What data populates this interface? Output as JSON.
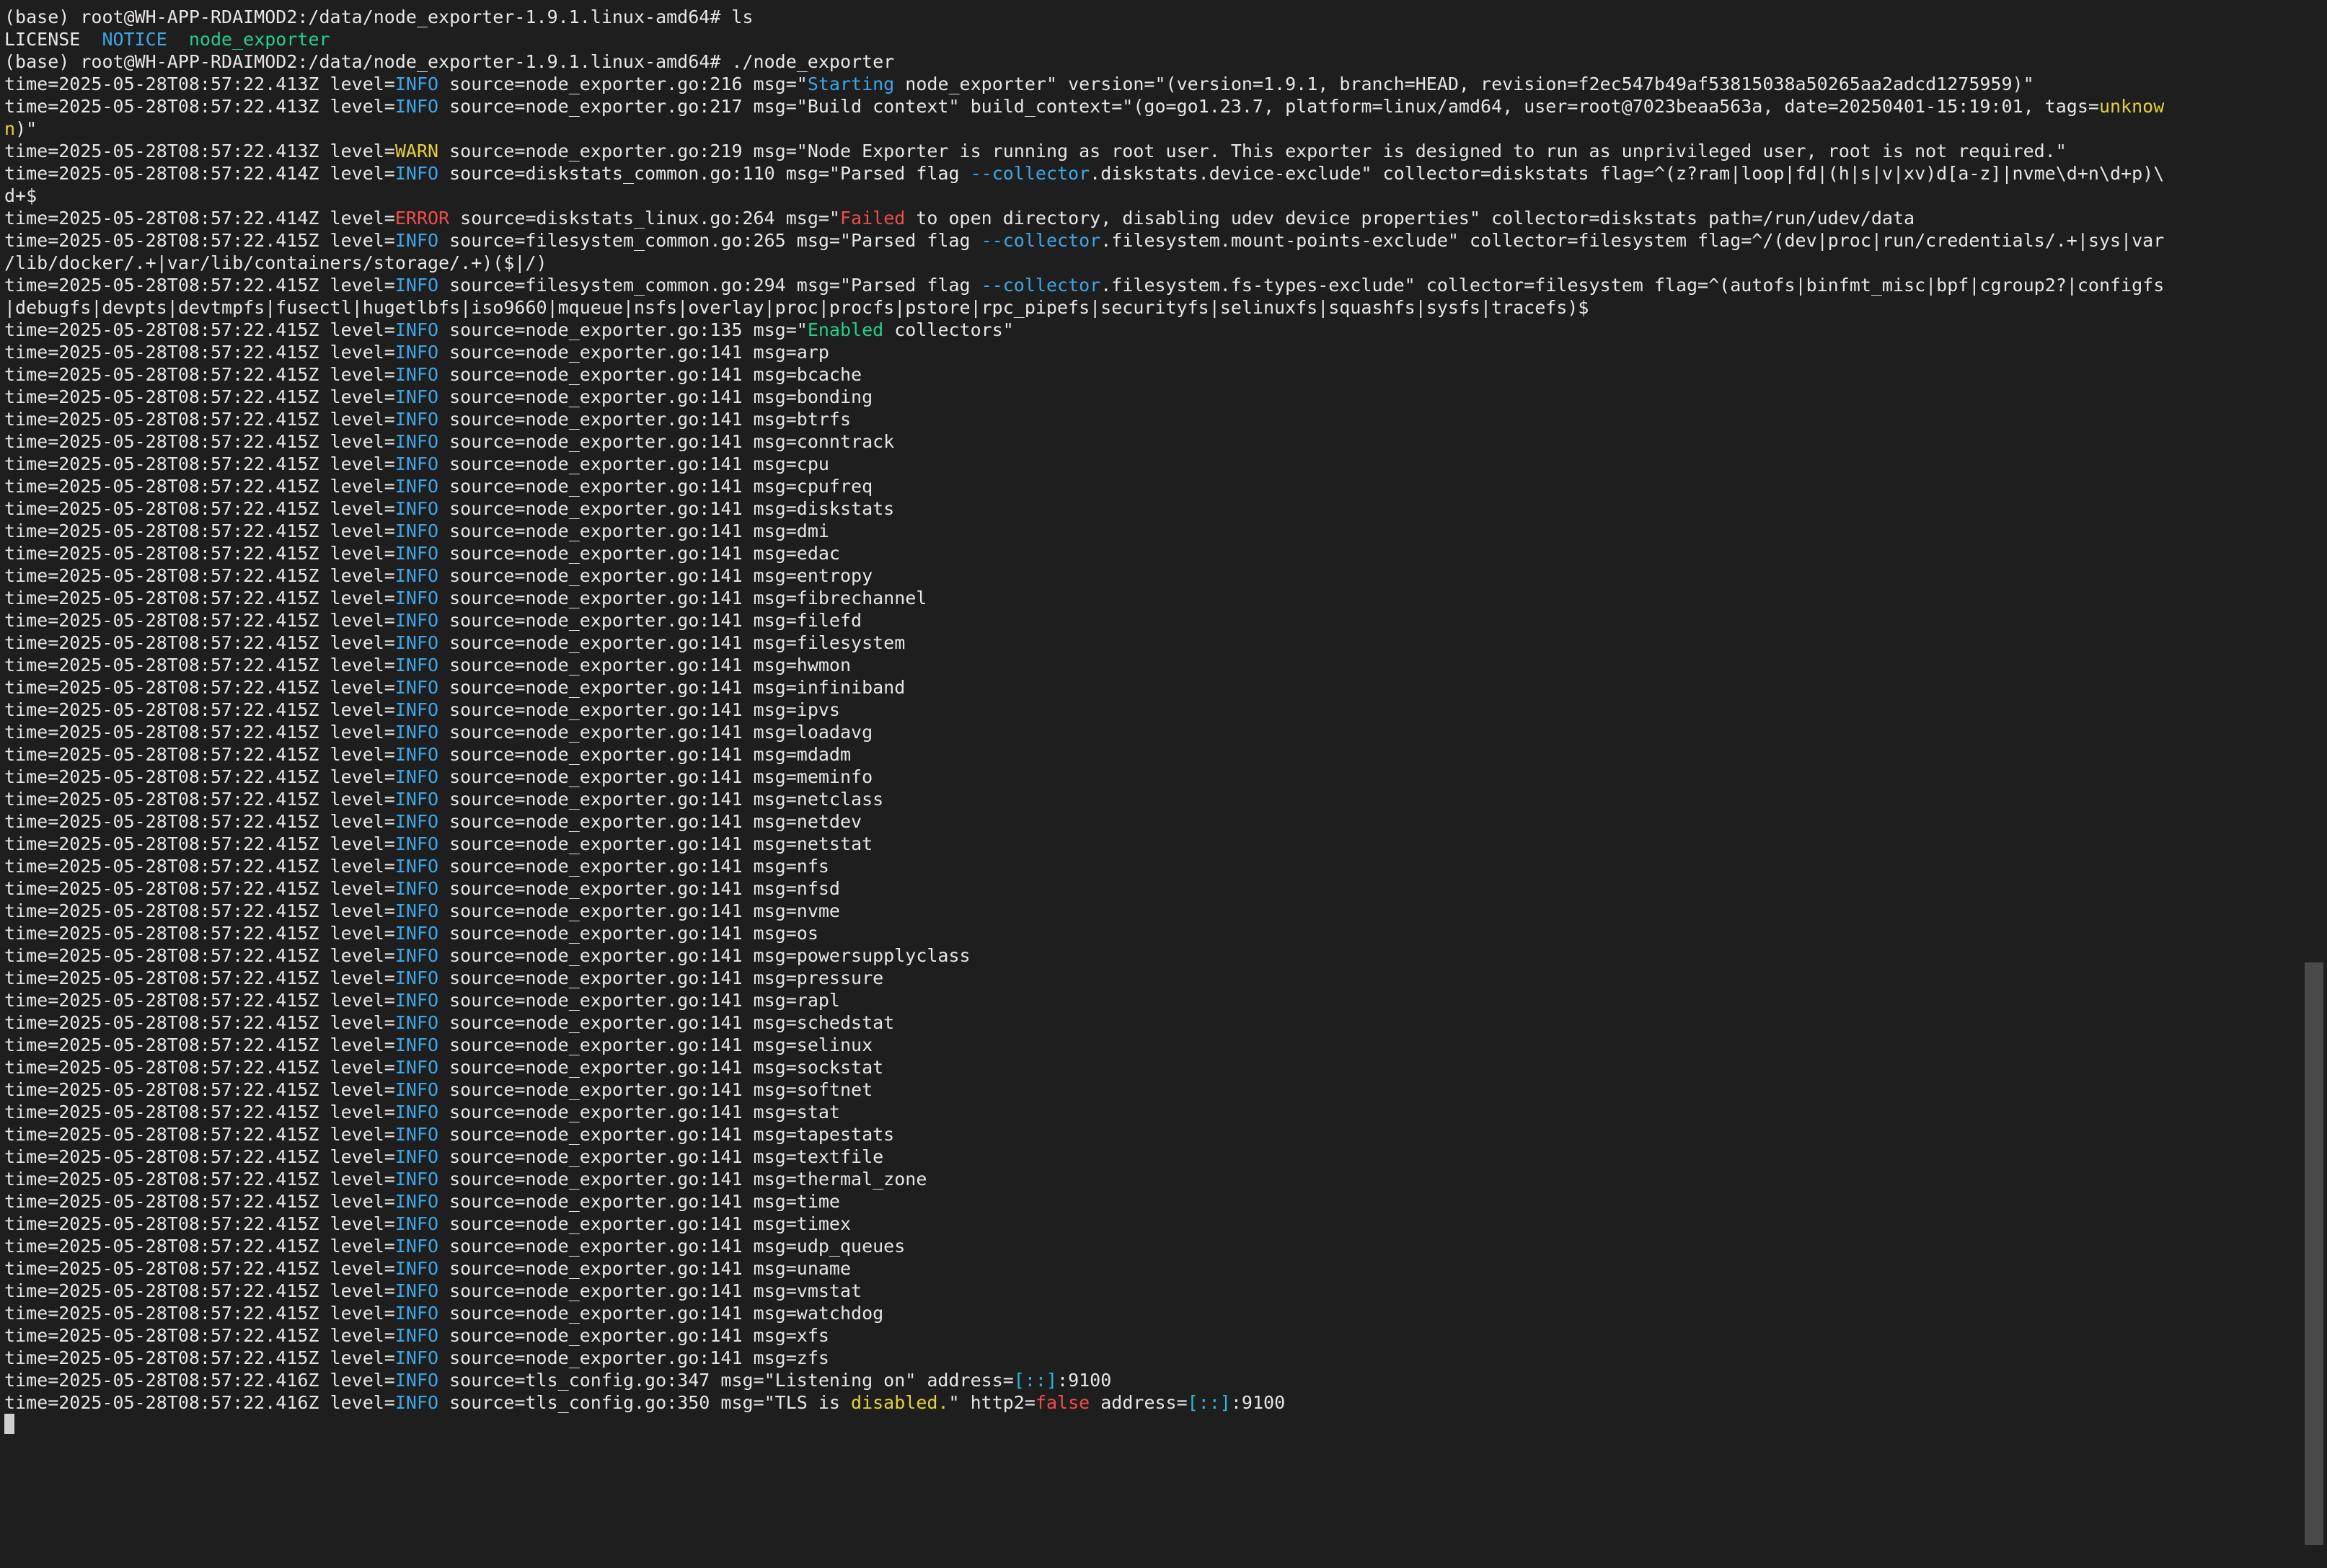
{
  "theme": {
    "background": "#1e1e1e",
    "foreground": "#e6e6e6",
    "info": "#3ea6e6",
    "warn": "#e5d23a",
    "error": "#f14c4c",
    "green": "#23d18b",
    "cyan": "#29b8db"
  },
  "terminal": {
    "lines": [
      [
        {
          "t": "(base) root@WH-APP-RDAIMOD2:/data/node_exporter-1.9.1.linux-amd64# ls",
          "c": "fg"
        }
      ],
      [
        {
          "t": "LICENSE  ",
          "c": "fg"
        },
        {
          "t": "NOTICE",
          "c": "blue"
        },
        {
          "t": "  node_exporter",
          "c": "green"
        }
      ],
      [
        {
          "t": "(base) root@WH-APP-RDAIMOD2:/data/node_exporter-1.9.1.linux-amd64# ./node_exporter",
          "c": "fg"
        }
      ],
      [
        {
          "t": "time=2025-05-28T08:57:22.413Z level=",
          "c": "fg"
        },
        {
          "t": "INFO",
          "c": "info"
        },
        {
          "t": " source=node_exporter.go:216 msg=\"",
          "c": "fg"
        },
        {
          "t": "Starting",
          "c": "blue"
        },
        {
          "t": " node_exporter\" version=\"(version=1.9.1, branch=HEAD, revision=f2ec547b49af53815038a50265aa2adcd1275959)\"",
          "c": "fg"
        }
      ],
      [
        {
          "t": "time=2025-05-28T08:57:22.413Z level=",
          "c": "fg"
        },
        {
          "t": "INFO",
          "c": "info"
        },
        {
          "t": " source=node_exporter.go:217 msg=\"Build context\" build_context=\"(go=go1.23.7, platform=linux/amd64, user=root@7023beaa563a, date=20250401-15:19:01, tags=",
          "c": "fg"
        },
        {
          "t": "unknow",
          "c": "yellow"
        }
      ],
      [
        {
          "t": "n",
          "c": "yellow"
        },
        {
          "t": ")\"",
          "c": "fg"
        }
      ],
      [
        {
          "t": "time=2025-05-28T08:57:22.413Z level=",
          "c": "fg"
        },
        {
          "t": "WARN",
          "c": "warn"
        },
        {
          "t": " source=node_exporter.go:219 msg=\"Node Exporter is running as root user. This exporter is designed to run as unprivileged user, root is not required.\"",
          "c": "fg"
        }
      ],
      [
        {
          "t": "time=2025-05-28T08:57:22.414Z level=",
          "c": "fg"
        },
        {
          "t": "INFO",
          "c": "info"
        },
        {
          "t": " source=diskstats_common.go:110 msg=\"Parsed flag ",
          "c": "fg"
        },
        {
          "t": "--collector",
          "c": "blue"
        },
        {
          "t": ".diskstats.device-exclude\" collector=diskstats flag=^(z?ram|loop|fd|(h|s|v|xv)d[a-z]|nvme\\d+n\\d+p)\\",
          "c": "fg"
        }
      ],
      [
        {
          "t": "d+$",
          "c": "fg"
        }
      ],
      [
        {
          "t": "time=2025-05-28T08:57:22.414Z level=",
          "c": "fg"
        },
        {
          "t": "ERROR",
          "c": "error"
        },
        {
          "t": " source=diskstats_linux.go:264 msg=\"",
          "c": "fg"
        },
        {
          "t": "Failed",
          "c": "red"
        },
        {
          "t": " to open directory, disabling udev device properties\" collector=diskstats path=/run/udev/data",
          "c": "fg"
        }
      ],
      [
        {
          "t": "time=2025-05-28T08:57:22.415Z level=",
          "c": "fg"
        },
        {
          "t": "INFO",
          "c": "info"
        },
        {
          "t": " source=filesystem_common.go:265 msg=\"Parsed flag ",
          "c": "fg"
        },
        {
          "t": "--collector",
          "c": "blue"
        },
        {
          "t": ".filesystem.mount-points-exclude\" collector=filesystem flag=^/(dev|proc|run/credentials/.+|sys|var",
          "c": "fg"
        }
      ],
      [
        {
          "t": "/lib/docker/.+|var/lib/containers/storage/.+)($|/)",
          "c": "fg"
        }
      ],
      [
        {
          "t": "time=2025-05-28T08:57:22.415Z level=",
          "c": "fg"
        },
        {
          "t": "INFO",
          "c": "info"
        },
        {
          "t": " source=filesystem_common.go:294 msg=\"Parsed flag ",
          "c": "fg"
        },
        {
          "t": "--collector",
          "c": "blue"
        },
        {
          "t": ".filesystem.fs-types-exclude\" collector=filesystem flag=^(autofs|binfmt_misc|bpf|cgroup2?|configfs",
          "c": "fg"
        }
      ],
      [
        {
          "t": "|debugfs|devpts|devtmpfs|fusectl|hugetlbfs|iso9660|mqueue|nsfs|overlay|proc|procfs|pstore|rpc_pipefs|securityfs|selinuxfs|squashfs|sysfs|tracefs)$",
          "c": "fg"
        }
      ],
      [
        {
          "t": "time=2025-05-28T08:57:22.415Z level=",
          "c": "fg"
        },
        {
          "t": "INFO",
          "c": "info"
        },
        {
          "t": " source=node_exporter.go:135 msg=\"",
          "c": "fg"
        },
        {
          "t": "Enabled",
          "c": "green"
        },
        {
          "t": " collectors\"",
          "c": "fg"
        }
      ],
      [
        {
          "t": "time=2025-05-28T08:57:22.415Z level=",
          "c": "fg"
        },
        {
          "t": "INFO",
          "c": "info"
        },
        {
          "t": " source=node_exporter.go:141 msg=arp",
          "c": "fg"
        }
      ],
      [
        {
          "t": "time=2025-05-28T08:57:22.415Z level=",
          "c": "fg"
        },
        {
          "t": "INFO",
          "c": "info"
        },
        {
          "t": " source=node_exporter.go:141 msg=bcache",
          "c": "fg"
        }
      ],
      [
        {
          "t": "time=2025-05-28T08:57:22.415Z level=",
          "c": "fg"
        },
        {
          "t": "INFO",
          "c": "info"
        },
        {
          "t": " source=node_exporter.go:141 msg=bonding",
          "c": "fg"
        }
      ],
      [
        {
          "t": "time=2025-05-28T08:57:22.415Z level=",
          "c": "fg"
        },
        {
          "t": "INFO",
          "c": "info"
        },
        {
          "t": " source=node_exporter.go:141 msg=btrfs",
          "c": "fg"
        }
      ],
      [
        {
          "t": "time=2025-05-28T08:57:22.415Z level=",
          "c": "fg"
        },
        {
          "t": "INFO",
          "c": "info"
        },
        {
          "t": " source=node_exporter.go:141 msg=conntrack",
          "c": "fg"
        }
      ],
      [
        {
          "t": "time=2025-05-28T08:57:22.415Z level=",
          "c": "fg"
        },
        {
          "t": "INFO",
          "c": "info"
        },
        {
          "t": " source=node_exporter.go:141 msg=cpu",
          "c": "fg"
        }
      ],
      [
        {
          "t": "time=2025-05-28T08:57:22.415Z level=",
          "c": "fg"
        },
        {
          "t": "INFO",
          "c": "info"
        },
        {
          "t": " source=node_exporter.go:141 msg=cpufreq",
          "c": "fg"
        }
      ],
      [
        {
          "t": "time=2025-05-28T08:57:22.415Z level=",
          "c": "fg"
        },
        {
          "t": "INFO",
          "c": "info"
        },
        {
          "t": " source=node_exporter.go:141 msg=diskstats",
          "c": "fg"
        }
      ],
      [
        {
          "t": "time=2025-05-28T08:57:22.415Z level=",
          "c": "fg"
        },
        {
          "t": "INFO",
          "c": "info"
        },
        {
          "t": " source=node_exporter.go:141 msg=dmi",
          "c": "fg"
        }
      ],
      [
        {
          "t": "time=2025-05-28T08:57:22.415Z level=",
          "c": "fg"
        },
        {
          "t": "INFO",
          "c": "info"
        },
        {
          "t": " source=node_exporter.go:141 msg=edac",
          "c": "fg"
        }
      ],
      [
        {
          "t": "time=2025-05-28T08:57:22.415Z level=",
          "c": "fg"
        },
        {
          "t": "INFO",
          "c": "info"
        },
        {
          "t": " source=node_exporter.go:141 msg=entropy",
          "c": "fg"
        }
      ],
      [
        {
          "t": "time=2025-05-28T08:57:22.415Z level=",
          "c": "fg"
        },
        {
          "t": "INFO",
          "c": "info"
        },
        {
          "t": " source=node_exporter.go:141 msg=fibrechannel",
          "c": "fg"
        }
      ],
      [
        {
          "t": "time=2025-05-28T08:57:22.415Z level=",
          "c": "fg"
        },
        {
          "t": "INFO",
          "c": "info"
        },
        {
          "t": " source=node_exporter.go:141 msg=filefd",
          "c": "fg"
        }
      ],
      [
        {
          "t": "time=2025-05-28T08:57:22.415Z level=",
          "c": "fg"
        },
        {
          "t": "INFO",
          "c": "info"
        },
        {
          "t": " source=node_exporter.go:141 msg=filesystem",
          "c": "fg"
        }
      ],
      [
        {
          "t": "time=2025-05-28T08:57:22.415Z level=",
          "c": "fg"
        },
        {
          "t": "INFO",
          "c": "info"
        },
        {
          "t": " source=node_exporter.go:141 msg=hwmon",
          "c": "fg"
        }
      ],
      [
        {
          "t": "time=2025-05-28T08:57:22.415Z level=",
          "c": "fg"
        },
        {
          "t": "INFO",
          "c": "info"
        },
        {
          "t": " source=node_exporter.go:141 msg=infiniband",
          "c": "fg"
        }
      ],
      [
        {
          "t": "time=2025-05-28T08:57:22.415Z level=",
          "c": "fg"
        },
        {
          "t": "INFO",
          "c": "info"
        },
        {
          "t": " source=node_exporter.go:141 msg=ipvs",
          "c": "fg"
        }
      ],
      [
        {
          "t": "time=2025-05-28T08:57:22.415Z level=",
          "c": "fg"
        },
        {
          "t": "INFO",
          "c": "info"
        },
        {
          "t": " source=node_exporter.go:141 msg=loadavg",
          "c": "fg"
        }
      ],
      [
        {
          "t": "time=2025-05-28T08:57:22.415Z level=",
          "c": "fg"
        },
        {
          "t": "INFO",
          "c": "info"
        },
        {
          "t": " source=node_exporter.go:141 msg=mdadm",
          "c": "fg"
        }
      ],
      [
        {
          "t": "time=2025-05-28T08:57:22.415Z level=",
          "c": "fg"
        },
        {
          "t": "INFO",
          "c": "info"
        },
        {
          "t": " source=node_exporter.go:141 msg=meminfo",
          "c": "fg"
        }
      ],
      [
        {
          "t": "time=2025-05-28T08:57:22.415Z level=",
          "c": "fg"
        },
        {
          "t": "INFO",
          "c": "info"
        },
        {
          "t": " source=node_exporter.go:141 msg=netclass",
          "c": "fg"
        }
      ],
      [
        {
          "t": "time=2025-05-28T08:57:22.415Z level=",
          "c": "fg"
        },
        {
          "t": "INFO",
          "c": "info"
        },
        {
          "t": " source=node_exporter.go:141 msg=netdev",
          "c": "fg"
        }
      ],
      [
        {
          "t": "time=2025-05-28T08:57:22.415Z level=",
          "c": "fg"
        },
        {
          "t": "INFO",
          "c": "info"
        },
        {
          "t": " source=node_exporter.go:141 msg=netstat",
          "c": "fg"
        }
      ],
      [
        {
          "t": "time=2025-05-28T08:57:22.415Z level=",
          "c": "fg"
        },
        {
          "t": "INFO",
          "c": "info"
        },
        {
          "t": " source=node_exporter.go:141 msg=nfs",
          "c": "fg"
        }
      ],
      [
        {
          "t": "time=2025-05-28T08:57:22.415Z level=",
          "c": "fg"
        },
        {
          "t": "INFO",
          "c": "info"
        },
        {
          "t": " source=node_exporter.go:141 msg=nfsd",
          "c": "fg"
        }
      ],
      [
        {
          "t": "time=2025-05-28T08:57:22.415Z level=",
          "c": "fg"
        },
        {
          "t": "INFO",
          "c": "info"
        },
        {
          "t": " source=node_exporter.go:141 msg=nvme",
          "c": "fg"
        }
      ],
      [
        {
          "t": "time=2025-05-28T08:57:22.415Z level=",
          "c": "fg"
        },
        {
          "t": "INFO",
          "c": "info"
        },
        {
          "t": " source=node_exporter.go:141 msg=os",
          "c": "fg"
        }
      ],
      [
        {
          "t": "time=2025-05-28T08:57:22.415Z level=",
          "c": "fg"
        },
        {
          "t": "INFO",
          "c": "info"
        },
        {
          "t": " source=node_exporter.go:141 msg=powersupplyclass",
          "c": "fg"
        }
      ],
      [
        {
          "t": "time=2025-05-28T08:57:22.415Z level=",
          "c": "fg"
        },
        {
          "t": "INFO",
          "c": "info"
        },
        {
          "t": " source=node_exporter.go:141 msg=pressure",
          "c": "fg"
        }
      ],
      [
        {
          "t": "time=2025-05-28T08:57:22.415Z level=",
          "c": "fg"
        },
        {
          "t": "INFO",
          "c": "info"
        },
        {
          "t": " source=node_exporter.go:141 msg=rapl",
          "c": "fg"
        }
      ],
      [
        {
          "t": "time=2025-05-28T08:57:22.415Z level=",
          "c": "fg"
        },
        {
          "t": "INFO",
          "c": "info"
        },
        {
          "t": " source=node_exporter.go:141 msg=schedstat",
          "c": "fg"
        }
      ],
      [
        {
          "t": "time=2025-05-28T08:57:22.415Z level=",
          "c": "fg"
        },
        {
          "t": "INFO",
          "c": "info"
        },
        {
          "t": " source=node_exporter.go:141 msg=selinux",
          "c": "fg"
        }
      ],
      [
        {
          "t": "time=2025-05-28T08:57:22.415Z level=",
          "c": "fg"
        },
        {
          "t": "INFO",
          "c": "info"
        },
        {
          "t": " source=node_exporter.go:141 msg=sockstat",
          "c": "fg"
        }
      ],
      [
        {
          "t": "time=2025-05-28T08:57:22.415Z level=",
          "c": "fg"
        },
        {
          "t": "INFO",
          "c": "info"
        },
        {
          "t": " source=node_exporter.go:141 msg=softnet",
          "c": "fg"
        }
      ],
      [
        {
          "t": "time=2025-05-28T08:57:22.415Z level=",
          "c": "fg"
        },
        {
          "t": "INFO",
          "c": "info"
        },
        {
          "t": " source=node_exporter.go:141 msg=stat",
          "c": "fg"
        }
      ],
      [
        {
          "t": "time=2025-05-28T08:57:22.415Z level=",
          "c": "fg"
        },
        {
          "t": "INFO",
          "c": "info"
        },
        {
          "t": " source=node_exporter.go:141 msg=tapestats",
          "c": "fg"
        }
      ],
      [
        {
          "t": "time=2025-05-28T08:57:22.415Z level=",
          "c": "fg"
        },
        {
          "t": "INFO",
          "c": "info"
        },
        {
          "t": " source=node_exporter.go:141 msg=textfile",
          "c": "fg"
        }
      ],
      [
        {
          "t": "time=2025-05-28T08:57:22.415Z level=",
          "c": "fg"
        },
        {
          "t": "INFO",
          "c": "info"
        },
        {
          "t": " source=node_exporter.go:141 msg=thermal_zone",
          "c": "fg"
        }
      ],
      [
        {
          "t": "time=2025-05-28T08:57:22.415Z level=",
          "c": "fg"
        },
        {
          "t": "INFO",
          "c": "info"
        },
        {
          "t": " source=node_exporter.go:141 msg=time",
          "c": "fg"
        }
      ],
      [
        {
          "t": "time=2025-05-28T08:57:22.415Z level=",
          "c": "fg"
        },
        {
          "t": "INFO",
          "c": "info"
        },
        {
          "t": " source=node_exporter.go:141 msg=timex",
          "c": "fg"
        }
      ],
      [
        {
          "t": "time=2025-05-28T08:57:22.415Z level=",
          "c": "fg"
        },
        {
          "t": "INFO",
          "c": "info"
        },
        {
          "t": " source=node_exporter.go:141 msg=udp_queues",
          "c": "fg"
        }
      ],
      [
        {
          "t": "time=2025-05-28T08:57:22.415Z level=",
          "c": "fg"
        },
        {
          "t": "INFO",
          "c": "info"
        },
        {
          "t": " source=node_exporter.go:141 msg=uname",
          "c": "fg"
        }
      ],
      [
        {
          "t": "time=2025-05-28T08:57:22.415Z level=",
          "c": "fg"
        },
        {
          "t": "INFO",
          "c": "info"
        },
        {
          "t": " source=node_exporter.go:141 msg=vmstat",
          "c": "fg"
        }
      ],
      [
        {
          "t": "time=2025-05-28T08:57:22.415Z level=",
          "c": "fg"
        },
        {
          "t": "INFO",
          "c": "info"
        },
        {
          "t": " source=node_exporter.go:141 msg=watchdog",
          "c": "fg"
        }
      ],
      [
        {
          "t": "time=2025-05-28T08:57:22.415Z level=",
          "c": "fg"
        },
        {
          "t": "INFO",
          "c": "info"
        },
        {
          "t": " source=node_exporter.go:141 msg=xfs",
          "c": "fg"
        }
      ],
      [
        {
          "t": "time=2025-05-28T08:57:22.415Z level=",
          "c": "fg"
        },
        {
          "t": "INFO",
          "c": "info"
        },
        {
          "t": " source=node_exporter.go:141 msg=zfs",
          "c": "fg"
        }
      ],
      [
        {
          "t": "time=2025-05-28T08:57:22.416Z level=",
          "c": "fg"
        },
        {
          "t": "INFO",
          "c": "info"
        },
        {
          "t": " source=tls_config.go:347 msg=\"Listening on\" address=",
          "c": "fg"
        },
        {
          "t": "[::]",
          "c": "cyan"
        },
        {
          "t": ":9100",
          "c": "fg"
        }
      ],
      [
        {
          "t": "time=2025-05-28T08:57:22.416Z level=",
          "c": "fg"
        },
        {
          "t": "INFO",
          "c": "info"
        },
        {
          "t": " source=tls_config.go:350 msg=\"TLS is ",
          "c": "fg"
        },
        {
          "t": "disabled.",
          "c": "yellow"
        },
        {
          "t": "\" http2=",
          "c": "fg"
        },
        {
          "t": "false",
          "c": "red"
        },
        {
          "t": " address=",
          "c": "fg"
        },
        {
          "t": "[::]",
          "c": "cyan"
        },
        {
          "t": ":9100",
          "c": "fg"
        }
      ]
    ]
  }
}
